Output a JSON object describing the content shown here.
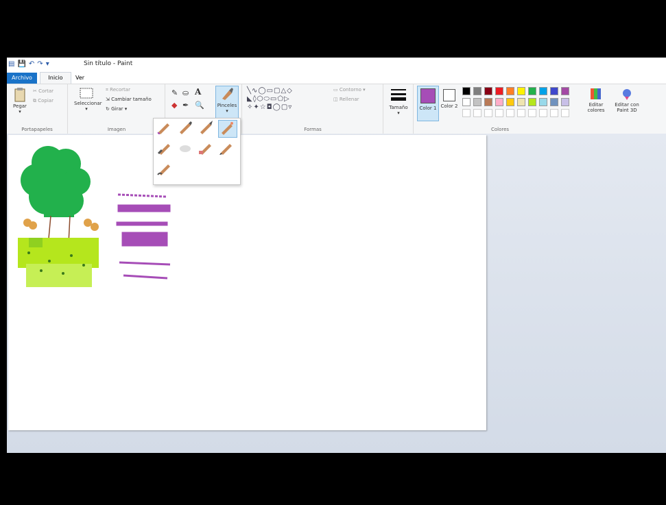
{
  "window": {
    "title": "Sin título - Paint"
  },
  "tabs": [
    {
      "label": "Archivo"
    },
    {
      "label": "Inicio"
    },
    {
      "label": "Ver"
    }
  ],
  "ribbon": {
    "clipboard": {
      "label": "Portapapeles",
      "paste": "Pegar",
      "cut": "Cortar",
      "copy": "Copiar"
    },
    "image": {
      "label": "Imagen",
      "select": "Seleccionar",
      "crop": "Recortar",
      "resize": "Cambiar tamaño",
      "rotate": "Girar"
    },
    "tools": {
      "brushes": "Pinceles"
    },
    "shapes": {
      "label": "Formas",
      "outline": "Contorno",
      "fill": "Rellenar"
    },
    "size": {
      "label": "Tamaño"
    },
    "colors": {
      "label": "Colores",
      "color1": "Color 1",
      "color2": "Color 2",
      "edit": "Editar colores",
      "paint3d": "Editar con Paint 3D"
    }
  },
  "palette": {
    "color1": "#a64db7",
    "color2": "#ffffff",
    "row1": [
      "#000000",
      "#7f7f7f",
      "#880015",
      "#ed1c24",
      "#ff7f27",
      "#fff200",
      "#22b14c",
      "#00a2e8",
      "#3f48cc",
      "#a349a4"
    ],
    "row2": [
      "#ffffff",
      "#c3c3c3",
      "#b97a57",
      "#ffaec9",
      "#ffc90e",
      "#efe4b0",
      "#b5e61d",
      "#99d9ea",
      "#7092be",
      "#c8bfe7"
    ]
  },
  "icons": {
    "save": "save-icon",
    "undo": "undo-icon",
    "redo": "redo-icon",
    "brush": "brush-icon"
  }
}
